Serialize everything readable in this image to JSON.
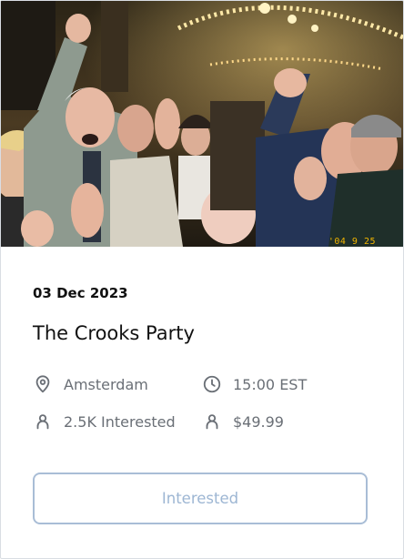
{
  "event": {
    "photo_stamp": "'04 9 25",
    "date": "03 Dec 2023",
    "title": "The Crooks Party",
    "location": "Amsterdam",
    "time": "15:00 EST",
    "interested_count": "2.5K Interested",
    "price": "$49.99",
    "button_label": "Interested"
  },
  "icons": {
    "location": "map-pin-icon",
    "time": "clock-icon",
    "interested": "user-icon",
    "price": "user-icon"
  },
  "colors": {
    "button_border": "#a9bdd6",
    "button_text": "#9db6d3",
    "text_primary": "#111111",
    "text_secondary": "#6a6f76"
  }
}
